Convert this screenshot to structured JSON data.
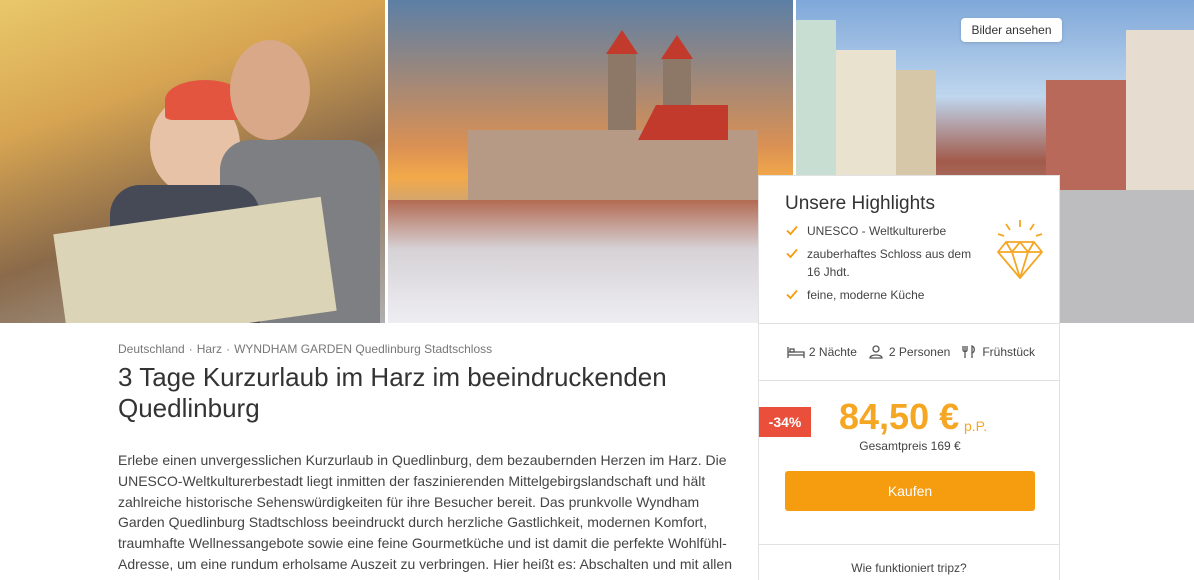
{
  "gallery": {
    "view_images_label": "Bilder ansehen"
  },
  "breadcrumb": {
    "items": [
      "Deutschland",
      "Harz",
      "WYNDHAM GARDEN Quedlinburg Stadtschloss"
    ],
    "separator": "·"
  },
  "title": "3 Tage Kurzurlaub im Harz im beeindruckenden Quedlinburg",
  "description": "Erlebe einen unvergesslichen Kurzurlaub in Quedlinburg, dem bezaubernden Herzen im Harz. Die UNESCO-Weltkulturerbestadt liegt inmitten der faszinierenden Mittelgebirgslandschaft und hält zahlreiche historische Sehenswürdigkeiten für ihre Besucher bereit. Das prunkvolle Wyndham Garden Quedlinburg Stadtschloss beeindruckt durch herzliche Gastlichkeit, modernen Komfort, traumhafte Wellnessangebote sowie eine feine Gourmetküche und ist damit die perfekte Wohlfühl-Adresse, um eine rundum erholsame Auszeit zu verbringen. Hier heißt es: Abschalten und mit allen Sinnen genießen!",
  "highlights": {
    "title": "Unsere Highlights",
    "items": [
      "UNESCO - Weltkulturerbe",
      "zauberhaftes Schloss aus dem 16 Jhdt.",
      "feine, moderne Küche"
    ],
    "icon": "diamond-icon"
  },
  "meta": {
    "nights": "2 Nächte",
    "persons": "2 Personen",
    "board": "Frühstück"
  },
  "pricing": {
    "discount": "-34%",
    "price": "84,50 €",
    "unit": "p.P.",
    "total": "Gesamtpreis 169 €"
  },
  "actions": {
    "buy_label": "Kaufen",
    "how_label": "Wie funktioniert tripz?"
  },
  "colors": {
    "accent": "#f59c0f",
    "price": "#f5a623",
    "discount": "#e94f3a"
  }
}
